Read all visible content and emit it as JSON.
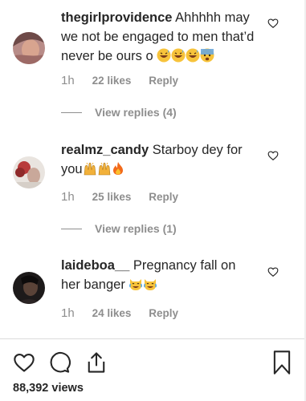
{
  "comments": [
    {
      "username": "thegirlprovidence",
      "text": "Ahhhhh may we not be engaged to men that’d never be ours o",
      "emojis": [
        "grinning-sweat",
        "grinning-sweat",
        "grinning-sweat",
        "anxious-sweat"
      ],
      "time": "1h",
      "likes": "22 likes",
      "reply": "Reply",
      "view_replies": "View replies (4)"
    },
    {
      "username": "realmz_candy",
      "text": "Starboy dey for you",
      "emojis": [
        "raising-hands",
        "raising-hands",
        "fire"
      ],
      "time": "1h",
      "likes": "25 likes",
      "reply": "Reply",
      "view_replies": "View replies (1)"
    },
    {
      "username": "laideboa__",
      "text": "Pregnancy fall on her banger",
      "emojis": [
        "tears-of-joy-cat",
        "tears-of-joy-cat"
      ],
      "time": "1h",
      "likes": "24 likes",
      "reply": "Reply"
    }
  ],
  "post": {
    "views": "88,392 views"
  },
  "colors": {
    "text": "#262626",
    "secondary": "#8e8e8e",
    "divider": "#dbdbdb"
  },
  "icons": [
    "heart-icon",
    "comment-icon",
    "share-icon",
    "bookmark-icon"
  ]
}
